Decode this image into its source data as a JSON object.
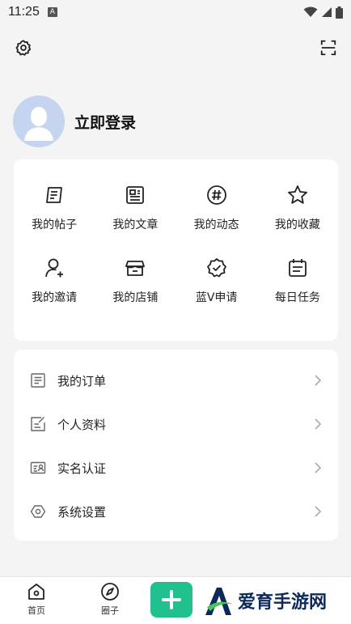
{
  "status_bar": {
    "time": "11:25",
    "notif_letter": "A"
  },
  "profile": {
    "login_label": "立即登录"
  },
  "grid": {
    "items": [
      {
        "label": "我的帖子",
        "icon": "post-icon"
      },
      {
        "label": "我的文章",
        "icon": "article-icon"
      },
      {
        "label": "我的动态",
        "icon": "hashtag-icon"
      },
      {
        "label": "我的收藏",
        "icon": "star-icon"
      },
      {
        "label": "我的邀请",
        "icon": "invite-user-icon"
      },
      {
        "label": "我的店铺",
        "icon": "store-icon"
      },
      {
        "label": "蓝V申请",
        "icon": "verified-badge-icon"
      },
      {
        "label": "每日任务",
        "icon": "calendar-icon"
      }
    ]
  },
  "list": {
    "items": [
      {
        "label": "我的订单",
        "icon": "order-icon"
      },
      {
        "label": "个人资料",
        "icon": "edit-profile-icon"
      },
      {
        "label": "实名认证",
        "icon": "id-card-icon"
      },
      {
        "label": "系统设置",
        "icon": "hexagon-settings-icon"
      }
    ]
  },
  "bottom_nav": {
    "home_label": "首页",
    "circle_label": "圈子"
  },
  "watermark": {
    "text": "爱育手游网"
  },
  "colors": {
    "accent": "#20c08f",
    "background": "#f4f4f5",
    "card": "#ffffff"
  }
}
